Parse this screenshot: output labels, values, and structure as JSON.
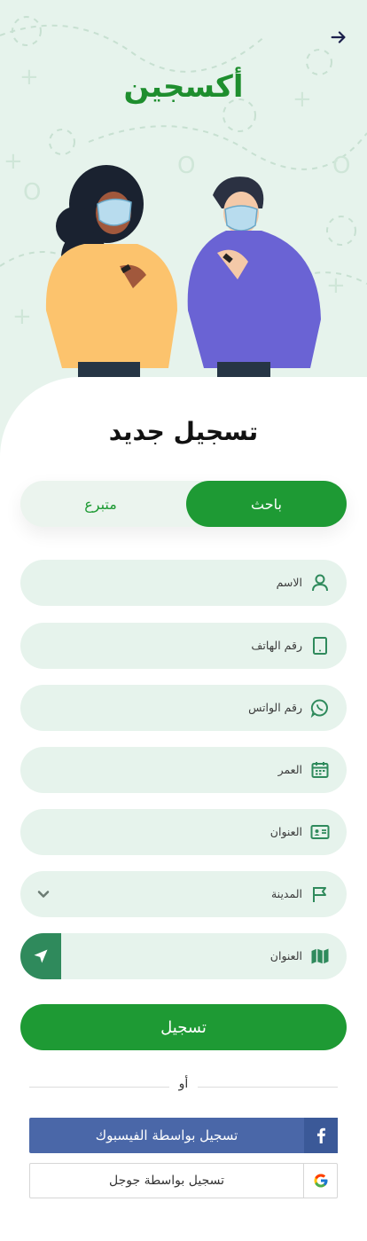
{
  "app": {
    "title": "أكسجين"
  },
  "form": {
    "title": "تسجيل جديد"
  },
  "toggle": {
    "active_label": "باحث",
    "inactive_label": "متبرع"
  },
  "fields": {
    "name": "الاسم",
    "phone": "رقم الهاتف",
    "whatsapp": "رقم الواتس",
    "age": "العمر",
    "address": "العنوان",
    "city": "المدينة",
    "location": "العنوان"
  },
  "actions": {
    "submit": "تسجيل",
    "or": "أو",
    "facebook": "تسجيل بواسطة الفيسبوك",
    "google": "تسجيل بواسطة جوجل"
  },
  "colors": {
    "primary": "#1e9a34",
    "title_green": "#1e8e2e",
    "field_bg": "#e6f3ec",
    "location_button": "#2f8a5c",
    "facebook": "#4a67a8"
  },
  "icons": [
    "back-arrow-icon",
    "user-icon",
    "phone-icon",
    "whatsapp-icon",
    "calendar-icon",
    "id-card-icon",
    "flag-icon",
    "chevron-down-icon",
    "map-icon",
    "navigation-arrow-icon",
    "facebook-icon",
    "google-icon"
  ]
}
